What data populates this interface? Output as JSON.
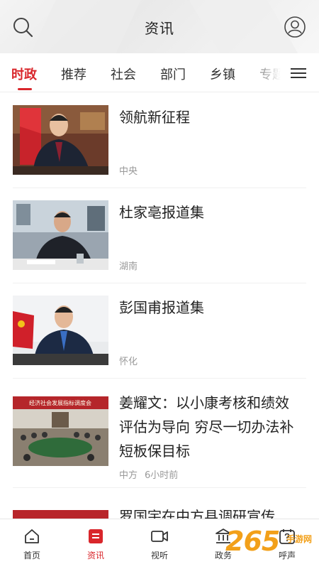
{
  "header": {
    "title": "资讯"
  },
  "tabs": [
    {
      "label": "时政",
      "active": true
    },
    {
      "label": "推荐"
    },
    {
      "label": "社会"
    },
    {
      "label": "部门"
    },
    {
      "label": "乡镇"
    },
    {
      "label": "专题"
    }
  ],
  "news": [
    {
      "title": "领航新征程",
      "source": "中央",
      "time": ""
    },
    {
      "title": "杜家亳报道集",
      "source": "湖南",
      "time": ""
    },
    {
      "title": "彭国甫报道集",
      "source": "怀化",
      "time": ""
    },
    {
      "title": "姜耀文：以小康考核和绩效评估为导向 穷尽一切办法补短板保目标",
      "source": "中方",
      "time": "6小时前",
      "banner_text": "经济社会发展指标调度会"
    },
    {
      "title": "罗国宇在中方县调研宣传",
      "source": "",
      "time": ""
    }
  ],
  "bottom_nav": [
    {
      "label": "首页",
      "icon": "home-icon"
    },
    {
      "label": "资讯",
      "icon": "news-icon",
      "active": true
    },
    {
      "label": "视听",
      "icon": "video-icon"
    },
    {
      "label": "政务",
      "icon": "government-icon"
    },
    {
      "label": "呼声",
      "icon": "voice-icon"
    }
  ],
  "watermark": {
    "number": "265",
    "text": "手游网"
  },
  "colors": {
    "accent": "#d9262b",
    "watermark": "#f2a01a"
  }
}
